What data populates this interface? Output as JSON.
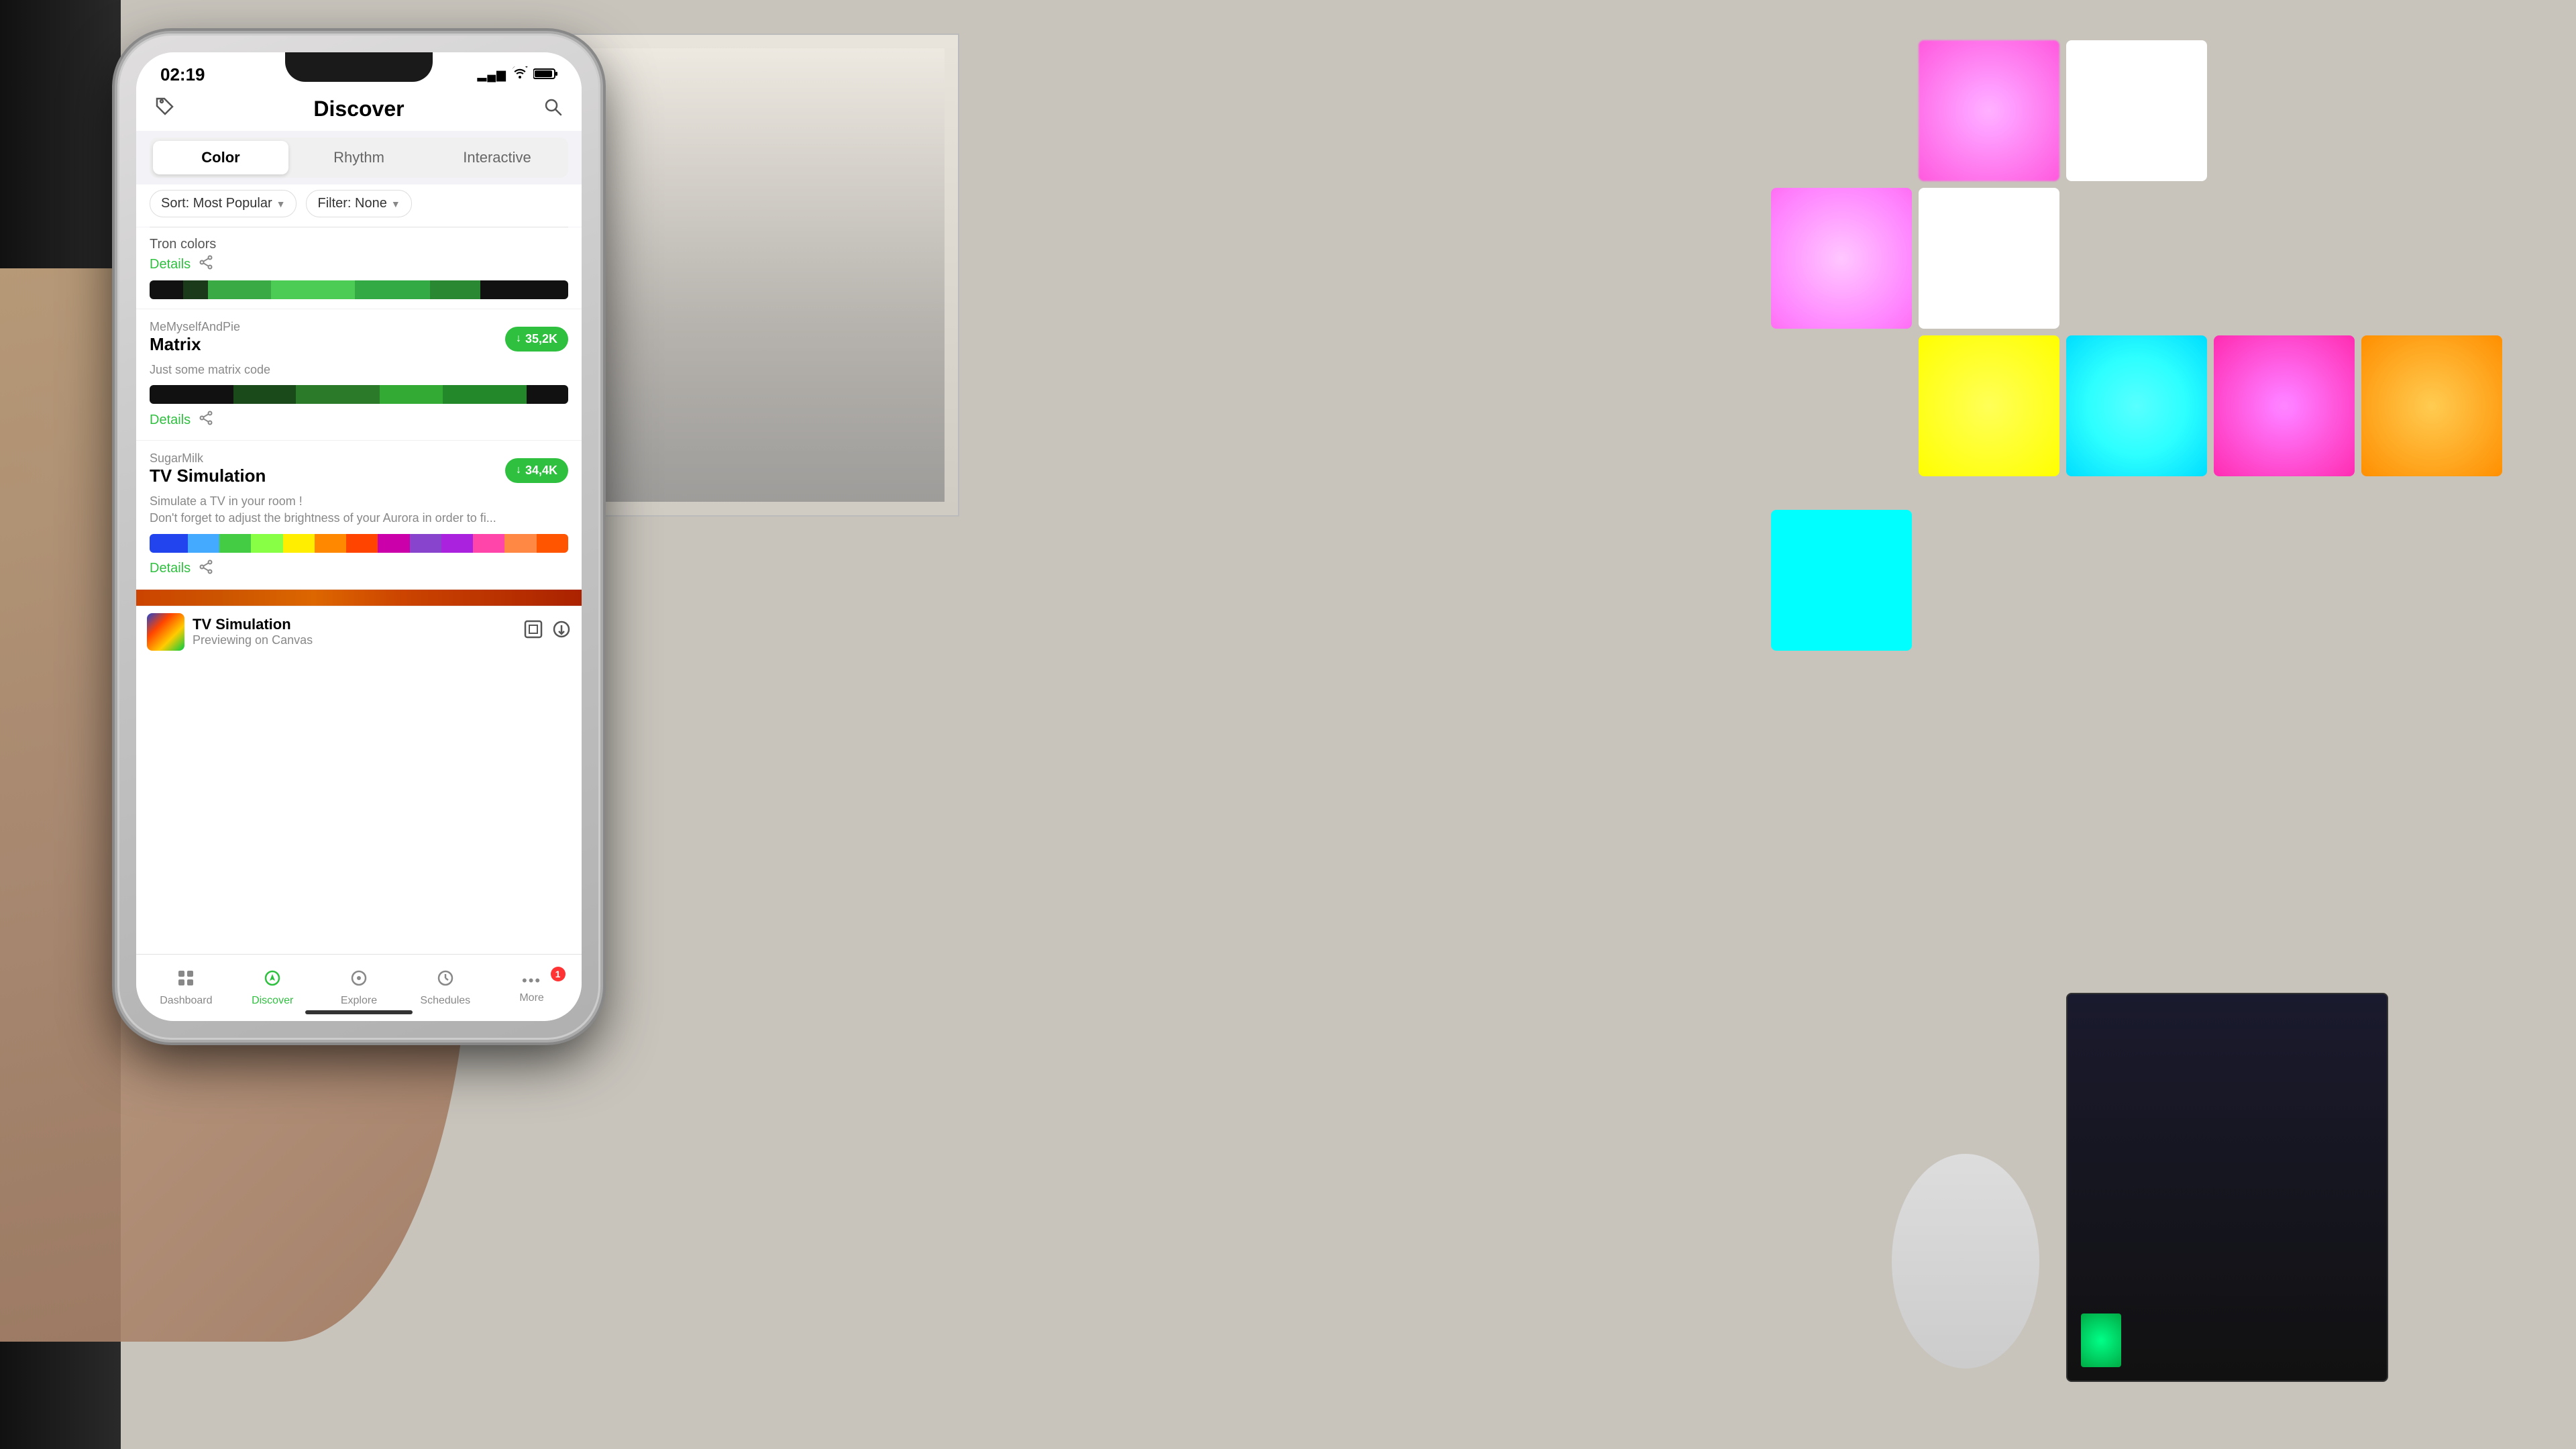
{
  "scene": {
    "bg_color": "#c8c4bc"
  },
  "phone": {
    "status_bar": {
      "time": "02:19",
      "signal_bars": "▂▄▆",
      "wifi": "wifi",
      "battery": "battery"
    },
    "header": {
      "title": "Discover",
      "left_icon": "tag-icon",
      "right_icon": "search-icon"
    },
    "tabs": [
      {
        "label": "Color",
        "active": true
      },
      {
        "label": "Rhythm",
        "active": false
      },
      {
        "label": "Interactive",
        "active": false
      }
    ],
    "filters": {
      "sort_label": "Sort: Most Popular",
      "filter_label": "Filter: None"
    },
    "effects": [
      {
        "id": "tron",
        "name_label": "Tron colors",
        "details_link": "Details",
        "colors": [
          "#111",
          "#334",
          "#2a6",
          "#4c8",
          "#3a5",
          "#2b4",
          "#111"
        ],
        "color_widths": [
          8,
          6,
          15,
          20,
          18,
          12,
          21
        ]
      },
      {
        "id": "matrix",
        "author": "MeMyselfAndPie",
        "name": "Matrix",
        "download_count": "35,2K",
        "description": "Just some matrix code",
        "details_link": "Details",
        "colors": [
          "#111",
          "#1a3",
          "#2b4",
          "#3c5",
          "#4d6",
          "#111"
        ],
        "color_widths": [
          20,
          15,
          20,
          15,
          20,
          10
        ]
      },
      {
        "id": "tv_simulation",
        "author": "SugarMilk",
        "name": "TV Simulation",
        "download_count": "34,4K",
        "description_line1": "Simulate a TV in your room !",
        "description_line2": "Don't forget to adjust the brightness of your Aurora in order to fi...",
        "details_link": "Details",
        "colors": [
          "#2244ff",
          "#44aaff",
          "#44cc44",
          "#88ff44",
          "#ffcc00",
          "#ff4400",
          "#cc00aa",
          "#ff00ff",
          "#ff8800",
          "#ff4400"
        ],
        "color_widths": [
          8,
          7,
          7,
          7,
          7,
          7,
          8,
          8,
          8,
          8,
          5,
          5,
          5,
          5
        ]
      }
    ],
    "preview_bar": {
      "effect_name": "TV Simulation",
      "sub_label": "Previewing on Canvas"
    },
    "bottom_nav": [
      {
        "id": "dashboard",
        "label": "Dashboard",
        "icon": "⌂",
        "active": false
      },
      {
        "id": "discover",
        "label": "Discover",
        "icon": "◈",
        "active": true
      },
      {
        "id": "explore",
        "label": "Explore",
        "icon": "⊙",
        "active": false
      },
      {
        "id": "schedules",
        "label": "Schedules",
        "icon": "⏰",
        "active": false
      },
      {
        "id": "more",
        "label": "More",
        "icon": "···",
        "badge": "1",
        "active": false
      }
    ]
  }
}
